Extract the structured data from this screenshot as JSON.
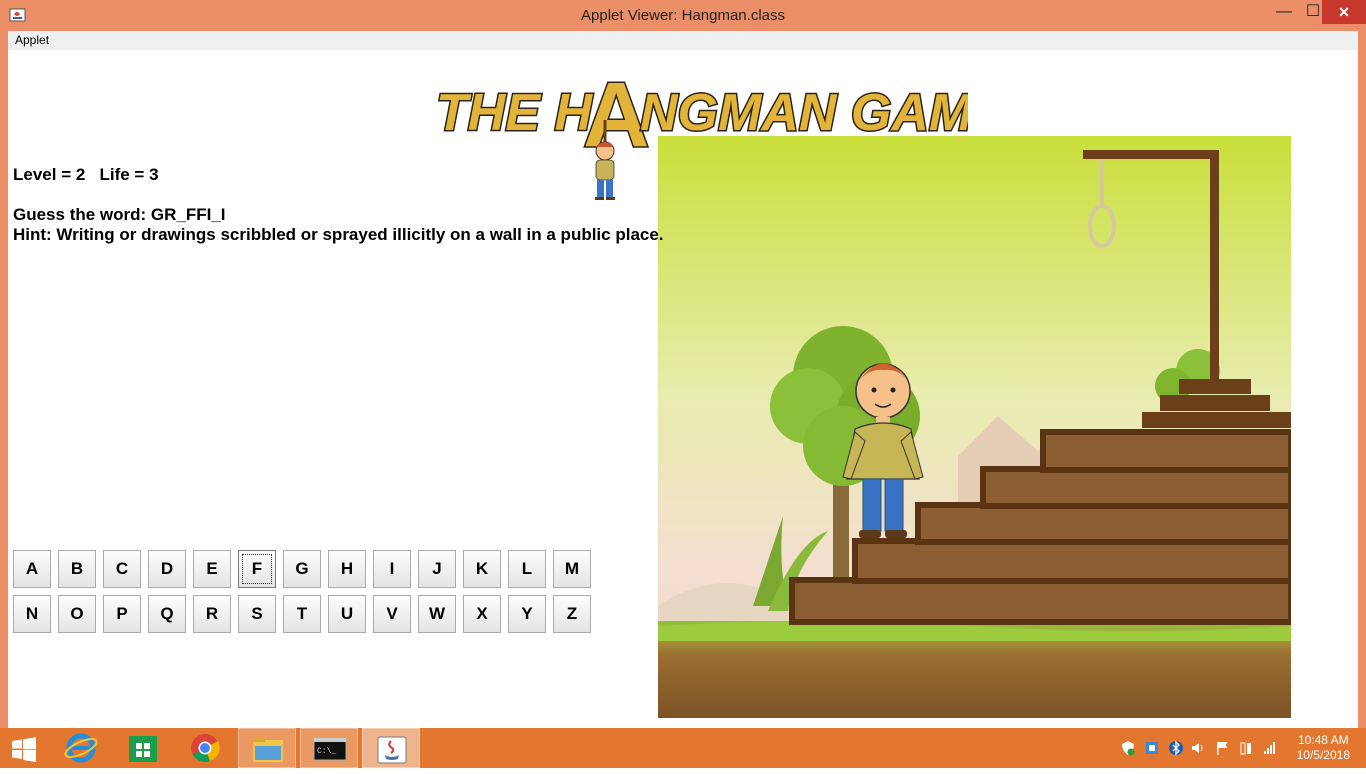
{
  "window": {
    "title": "Applet Viewer: Hangman.class",
    "minimize_label": "—",
    "maximize_label": "☐",
    "close_label": "✕"
  },
  "menu": {
    "applet_label": "Applet"
  },
  "game": {
    "logo_text_left": "THE H",
    "logo_text_a": "A",
    "logo_text_right": "NGMAN GAME",
    "level_line": "Level = 2   Life = 3",
    "guess_line": "Guess the word: GR_FFI_I",
    "hint_line": "Hint: Writing or drawings scribbled or sprayed illicitly on a wall in a public place.",
    "keys_row1": [
      "A",
      "B",
      "C",
      "D",
      "E",
      "F",
      "G",
      "H",
      "I",
      "J",
      "K",
      "L",
      "M"
    ],
    "keys_row2": [
      "N",
      "O",
      "P",
      "Q",
      "R",
      "S",
      "T",
      "U",
      "V",
      "W",
      "X",
      "Y",
      "Z"
    ],
    "focused_key": "F"
  },
  "taskbar": {
    "time": "10:48 AM",
    "date": "10/5/2018",
    "apps": [
      "start-icon",
      "internet-explorer-icon",
      "store-icon",
      "chrome-icon",
      "file-explorer-icon",
      "command-prompt-icon",
      "java-icon"
    ]
  },
  "colors": {
    "titlebar": "#ec8e68",
    "taskbar": "#e4772f",
    "logo_yellow": "#e2b53a",
    "wood": "#6b3f1a"
  }
}
